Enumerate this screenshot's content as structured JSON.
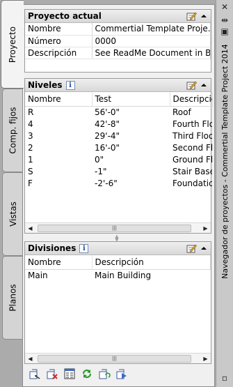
{
  "tabs": [
    {
      "label": "Proyecto"
    },
    {
      "label": "Comp. fijos"
    },
    {
      "label": "Vistas"
    },
    {
      "label": "Planos"
    }
  ],
  "palette_title": "Navegador de proyectos - Commertial Template Project 2014",
  "current_project": {
    "title": "Proyecto actual",
    "rows": [
      {
        "key": "Nombre",
        "value": "Commertial Template Proje..."
      },
      {
        "key": "Número",
        "value": "0000"
      },
      {
        "key": "Descripción",
        "value": "See ReadMe Document in B..."
      }
    ]
  },
  "levels": {
    "title": "Niveles",
    "columns": [
      "Nombre",
      "Test",
      "Descripció"
    ],
    "rows": [
      [
        "R",
        "56'-0\"",
        "Roof"
      ],
      [
        "4",
        "42'-8\"",
        "Fourth Flo"
      ],
      [
        "3",
        "29'-4\"",
        "Third Floo"
      ],
      [
        "2",
        "16'-0\"",
        "Second Fl"
      ],
      [
        "1",
        "0\"",
        "Ground Fl"
      ],
      [
        "S",
        "-1\"",
        "Stair Base"
      ],
      [
        "F",
        "-2'-6\"",
        "Foundatic"
      ]
    ]
  },
  "divisions": {
    "title": "Divisiones",
    "columns": [
      "Nombre",
      "Descripción"
    ],
    "rows": [
      [
        "Main",
        "Main Building"
      ]
    ]
  },
  "icons": {
    "close": "close-icon",
    "autohide": "autohide-icon",
    "properties": "properties-icon"
  }
}
